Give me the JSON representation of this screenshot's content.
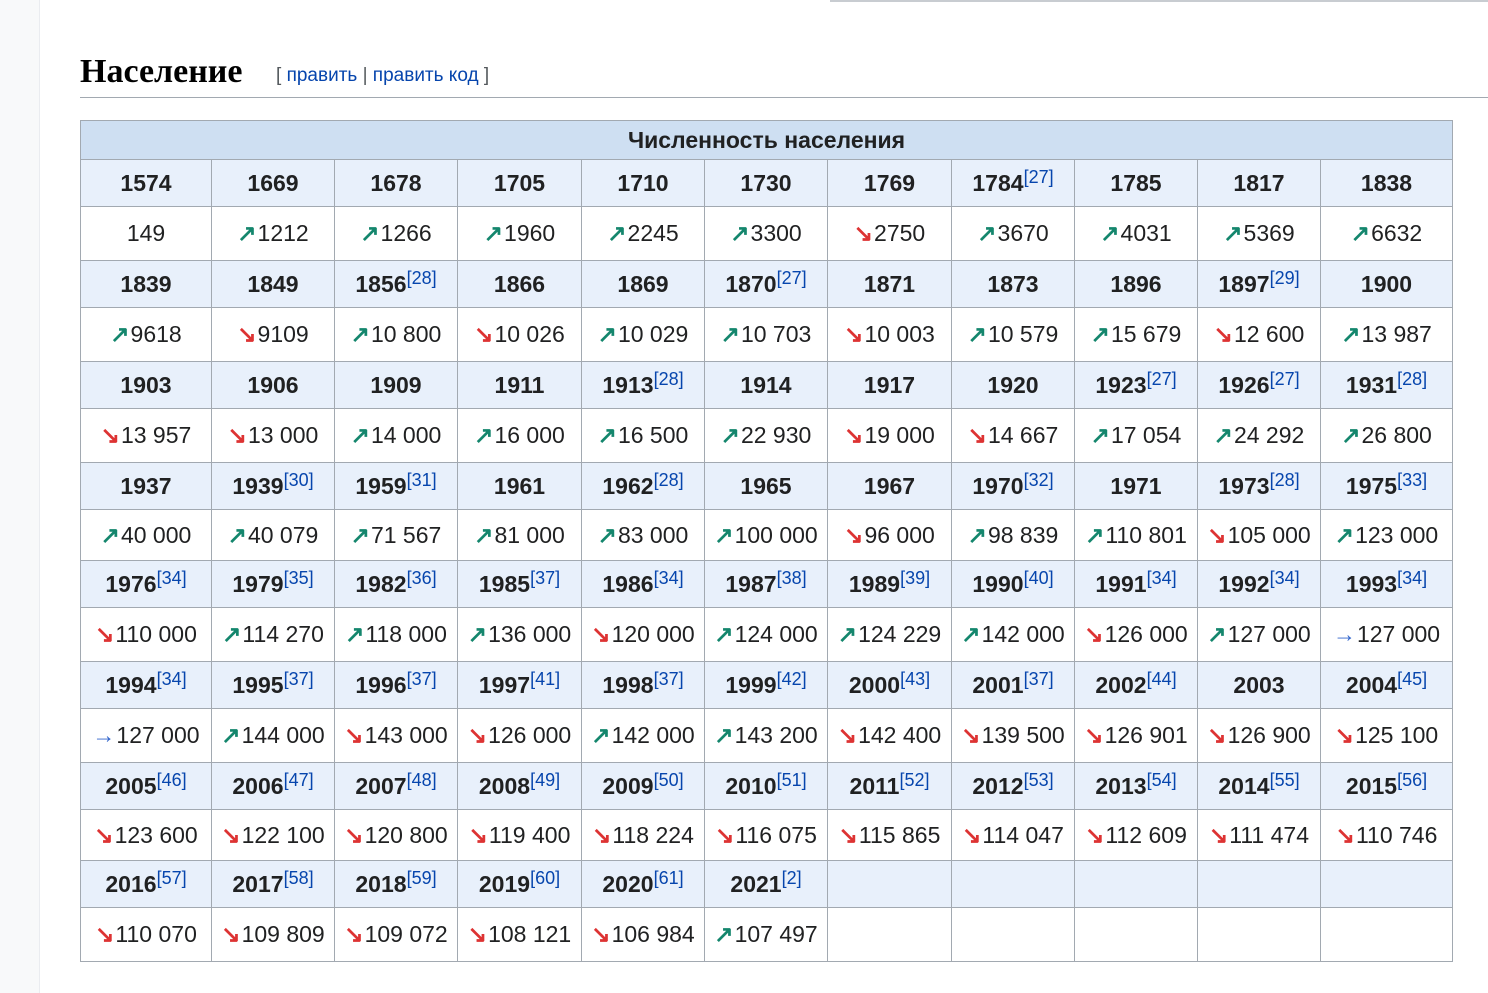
{
  "section": {
    "title": "Население",
    "edit_open": "[",
    "edit_label": "править",
    "edit_sep": "|",
    "edit_code_label": "править код",
    "edit_close": "]"
  },
  "trend_symbols": {
    "up": "↗",
    "down": "↘",
    "same": "→"
  },
  "colors": {
    "up": "#14866d",
    "down": "#dd3333",
    "same": "#3366cc",
    "header_bg": "#cedff2",
    "year_bg": "#e8f0fb",
    "link": "#0645ad"
  },
  "table": {
    "title": "Численность населения",
    "rows": [
      {
        "years": [
          {
            "year": "1574",
            "ref": ""
          },
          {
            "year": "1669",
            "ref": ""
          },
          {
            "year": "1678",
            "ref": ""
          },
          {
            "year": "1705",
            "ref": ""
          },
          {
            "year": "1710",
            "ref": ""
          },
          {
            "year": "1730",
            "ref": ""
          },
          {
            "year": "1769",
            "ref": ""
          },
          {
            "year": "1784",
            "ref": "[27]"
          },
          {
            "year": "1785",
            "ref": ""
          },
          {
            "year": "1817",
            "ref": ""
          },
          {
            "year": "1838",
            "ref": ""
          }
        ],
        "values": [
          {
            "trend": "",
            "value": "149"
          },
          {
            "trend": "up",
            "value": "1212"
          },
          {
            "trend": "up",
            "value": "1266"
          },
          {
            "trend": "up",
            "value": "1960"
          },
          {
            "trend": "up",
            "value": "2245"
          },
          {
            "trend": "up",
            "value": "3300"
          },
          {
            "trend": "down",
            "value": "2750"
          },
          {
            "trend": "up",
            "value": "3670"
          },
          {
            "trend": "up",
            "value": "4031"
          },
          {
            "trend": "up",
            "value": "5369"
          },
          {
            "trend": "up",
            "value": "6632"
          }
        ]
      },
      {
        "years": [
          {
            "year": "1839",
            "ref": ""
          },
          {
            "year": "1849",
            "ref": ""
          },
          {
            "year": "1856",
            "ref": "[28]"
          },
          {
            "year": "1866",
            "ref": ""
          },
          {
            "year": "1869",
            "ref": ""
          },
          {
            "year": "1870",
            "ref": "[27]"
          },
          {
            "year": "1871",
            "ref": ""
          },
          {
            "year": "1873",
            "ref": ""
          },
          {
            "year": "1896",
            "ref": ""
          },
          {
            "year": "1897",
            "ref": "[29]"
          },
          {
            "year": "1900",
            "ref": ""
          }
        ],
        "values": [
          {
            "trend": "up",
            "value": "9618"
          },
          {
            "trend": "down",
            "value": "9109"
          },
          {
            "trend": "up",
            "value": "10 800"
          },
          {
            "trend": "down",
            "value": "10 026"
          },
          {
            "trend": "up",
            "value": "10 029"
          },
          {
            "trend": "up",
            "value": "10 703"
          },
          {
            "trend": "down",
            "value": "10 003"
          },
          {
            "trend": "up",
            "value": "10 579"
          },
          {
            "trend": "up",
            "value": "15 679"
          },
          {
            "trend": "down",
            "value": "12 600"
          },
          {
            "trend": "up",
            "value": "13 987"
          }
        ]
      },
      {
        "years": [
          {
            "year": "1903",
            "ref": ""
          },
          {
            "year": "1906",
            "ref": ""
          },
          {
            "year": "1909",
            "ref": ""
          },
          {
            "year": "1911",
            "ref": ""
          },
          {
            "year": "1913",
            "ref": "[28]"
          },
          {
            "year": "1914",
            "ref": ""
          },
          {
            "year": "1917",
            "ref": ""
          },
          {
            "year": "1920",
            "ref": ""
          },
          {
            "year": "1923",
            "ref": "[27]"
          },
          {
            "year": "1926",
            "ref": "[27]"
          },
          {
            "year": "1931",
            "ref": "[28]"
          }
        ],
        "values": [
          {
            "trend": "down",
            "value": "13 957"
          },
          {
            "trend": "down",
            "value": "13 000"
          },
          {
            "trend": "up",
            "value": "14 000"
          },
          {
            "trend": "up",
            "value": "16 000"
          },
          {
            "trend": "up",
            "value": "16 500"
          },
          {
            "trend": "up",
            "value": "22 930"
          },
          {
            "trend": "down",
            "value": "19 000"
          },
          {
            "trend": "down",
            "value": "14 667"
          },
          {
            "trend": "up",
            "value": "17 054"
          },
          {
            "trend": "up",
            "value": "24 292"
          },
          {
            "trend": "up",
            "value": "26 800"
          }
        ]
      },
      {
        "years": [
          {
            "year": "1937",
            "ref": ""
          },
          {
            "year": "1939",
            "ref": "[30]"
          },
          {
            "year": "1959",
            "ref": "[31]"
          },
          {
            "year": "1961",
            "ref": ""
          },
          {
            "year": "1962",
            "ref": "[28]"
          },
          {
            "year": "1965",
            "ref": ""
          },
          {
            "year": "1967",
            "ref": ""
          },
          {
            "year": "1970",
            "ref": "[32]"
          },
          {
            "year": "1971",
            "ref": ""
          },
          {
            "year": "1973",
            "ref": "[28]"
          },
          {
            "year": "1975",
            "ref": "[33]"
          }
        ],
        "values": [
          {
            "trend": "up",
            "value": "40 000"
          },
          {
            "trend": "up",
            "value": "40 079"
          },
          {
            "trend": "up",
            "value": "71 567"
          },
          {
            "trend": "up",
            "value": "81 000"
          },
          {
            "trend": "up",
            "value": "83 000"
          },
          {
            "trend": "up",
            "value": "100 000"
          },
          {
            "trend": "down",
            "value": "96 000"
          },
          {
            "trend": "up",
            "value": "98 839"
          },
          {
            "trend": "up",
            "value": "110 801"
          },
          {
            "trend": "down",
            "value": "105 000"
          },
          {
            "trend": "up",
            "value": "123 000"
          }
        ]
      },
      {
        "years": [
          {
            "year": "1976",
            "ref": "[34]"
          },
          {
            "year": "1979",
            "ref": "[35]"
          },
          {
            "year": "1982",
            "ref": "[36]"
          },
          {
            "year": "1985",
            "ref": "[37]"
          },
          {
            "year": "1986",
            "ref": "[34]"
          },
          {
            "year": "1987",
            "ref": "[38]"
          },
          {
            "year": "1989",
            "ref": "[39]"
          },
          {
            "year": "1990",
            "ref": "[40]"
          },
          {
            "year": "1991",
            "ref": "[34]"
          },
          {
            "year": "1992",
            "ref": "[34]"
          },
          {
            "year": "1993",
            "ref": "[34]"
          }
        ],
        "values": [
          {
            "trend": "down",
            "value": "110 000"
          },
          {
            "trend": "up",
            "value": "114 270"
          },
          {
            "trend": "up",
            "value": "118 000"
          },
          {
            "trend": "up",
            "value": "136 000"
          },
          {
            "trend": "down",
            "value": "120 000"
          },
          {
            "trend": "up",
            "value": "124 000"
          },
          {
            "trend": "up",
            "value": "124 229"
          },
          {
            "trend": "up",
            "value": "142 000"
          },
          {
            "trend": "down",
            "value": "126 000"
          },
          {
            "trend": "up",
            "value": "127 000"
          },
          {
            "trend": "same",
            "value": "127 000"
          }
        ]
      },
      {
        "years": [
          {
            "year": "1994",
            "ref": "[34]"
          },
          {
            "year": "1995",
            "ref": "[37]"
          },
          {
            "year": "1996",
            "ref": "[37]"
          },
          {
            "year": "1997",
            "ref": "[41]"
          },
          {
            "year": "1998",
            "ref": "[37]"
          },
          {
            "year": "1999",
            "ref": "[42]"
          },
          {
            "year": "2000",
            "ref": "[43]"
          },
          {
            "year": "2001",
            "ref": "[37]"
          },
          {
            "year": "2002",
            "ref": "[44]"
          },
          {
            "year": "2003",
            "ref": ""
          },
          {
            "year": "2004",
            "ref": "[45]"
          }
        ],
        "values": [
          {
            "trend": "same",
            "value": "127 000"
          },
          {
            "trend": "up",
            "value": "144 000"
          },
          {
            "trend": "down",
            "value": "143 000"
          },
          {
            "trend": "down",
            "value": "126 000"
          },
          {
            "trend": "up",
            "value": "142 000"
          },
          {
            "trend": "up",
            "value": "143 200"
          },
          {
            "trend": "down",
            "value": "142 400"
          },
          {
            "trend": "down",
            "value": "139 500"
          },
          {
            "trend": "down",
            "value": "126 901"
          },
          {
            "trend": "down",
            "value": "126 900"
          },
          {
            "trend": "down",
            "value": "125 100"
          }
        ]
      },
      {
        "years": [
          {
            "year": "2005",
            "ref": "[46]"
          },
          {
            "year": "2006",
            "ref": "[47]"
          },
          {
            "year": "2007",
            "ref": "[48]"
          },
          {
            "year": "2008",
            "ref": "[49]"
          },
          {
            "year": "2009",
            "ref": "[50]"
          },
          {
            "year": "2010",
            "ref": "[51]"
          },
          {
            "year": "2011",
            "ref": "[52]"
          },
          {
            "year": "2012",
            "ref": "[53]"
          },
          {
            "year": "2013",
            "ref": "[54]"
          },
          {
            "year": "2014",
            "ref": "[55]"
          },
          {
            "year": "2015",
            "ref": "[56]"
          }
        ],
        "values": [
          {
            "trend": "down",
            "value": "123 600"
          },
          {
            "trend": "down",
            "value": "122 100"
          },
          {
            "trend": "down",
            "value": "120 800"
          },
          {
            "trend": "down",
            "value": "119 400"
          },
          {
            "trend": "down",
            "value": "118 224"
          },
          {
            "trend": "down",
            "value": "116 075"
          },
          {
            "trend": "down",
            "value": "115 865"
          },
          {
            "trend": "down",
            "value": "114 047"
          },
          {
            "trend": "down",
            "value": "112 609"
          },
          {
            "trend": "down",
            "value": "111 474"
          },
          {
            "trend": "down",
            "value": "110 746"
          }
        ]
      },
      {
        "years": [
          {
            "year": "2016",
            "ref": "[57]"
          },
          {
            "year": "2017",
            "ref": "[58]"
          },
          {
            "year": "2018",
            "ref": "[59]"
          },
          {
            "year": "2019",
            "ref": "[60]"
          },
          {
            "year": "2020",
            "ref": "[61]"
          },
          {
            "year": "2021",
            "ref": "[2]"
          },
          {
            "year": "",
            "ref": ""
          },
          {
            "year": "",
            "ref": ""
          },
          {
            "year": "",
            "ref": ""
          },
          {
            "year": "",
            "ref": ""
          },
          {
            "year": "",
            "ref": ""
          }
        ],
        "values": [
          {
            "trend": "down",
            "value": "110 070"
          },
          {
            "trend": "down",
            "value": "109 809"
          },
          {
            "trend": "down",
            "value": "109 072"
          },
          {
            "trend": "down",
            "value": "108 121"
          },
          {
            "trend": "down",
            "value": "106 984"
          },
          {
            "trend": "up",
            "value": "107 497"
          },
          {
            "trend": "",
            "value": ""
          },
          {
            "trend": "",
            "value": ""
          },
          {
            "trend": "",
            "value": ""
          },
          {
            "trend": "",
            "value": ""
          },
          {
            "trend": "",
            "value": ""
          }
        ]
      }
    ]
  }
}
